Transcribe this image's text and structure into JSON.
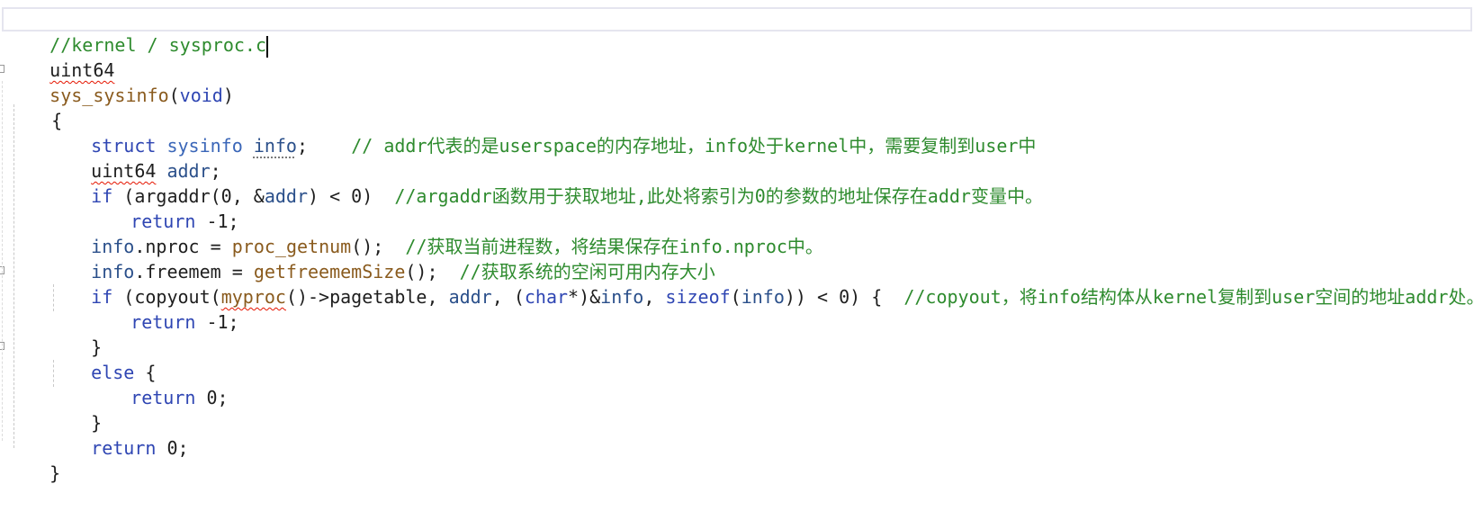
{
  "colors": {
    "comment": "#2e8b2e",
    "keyword": "#2f46b3",
    "type": "#3a66b8",
    "function": "#8a5b1e",
    "variable": "#2a4f8a",
    "text": "#1e1e1e",
    "squiggle": "#e51400",
    "current_line_border": "#e5e5ef"
  },
  "code": {
    "header_comment": "//kernel / sysproc.c",
    "line2": {
      "type": "uint64"
    },
    "line3": {
      "func": "sys_sysinfo",
      "paren_open": "(",
      "param": "void",
      "paren_close": ")"
    },
    "line4": {
      "brace": "{"
    },
    "line5": {
      "kw": "struct",
      "type": "sysinfo",
      "var": "info",
      "semi": ";",
      "comment": "// addr代表的是userspace的内存地址，info处于kernel中，需要复制到user中"
    },
    "line6": {
      "type": "uint64",
      "var": "addr",
      "semi": ";"
    },
    "line7": {
      "kw": "if",
      "pre": " (argaddr(0, &",
      "var": "addr",
      "post": ") < 0)  ",
      "comment": "//argaddr函数用于获取地址,此处将索引为0的参数的地址保存在addr变量中。"
    },
    "line8": {
      "kw": "return",
      "rest": " -1;"
    },
    "line9": {
      "var": "info",
      "dot": ".",
      "field": "nproc",
      "eq": " = ",
      "func": "proc_getnum",
      "call": "();  ",
      "comment": "//获取当前进程数，将结果保存在info.nproc中。"
    },
    "line10": {
      "var": "info",
      "dot": ".",
      "field": "freemem",
      "eq": " = ",
      "func": "getfreememSize",
      "call": "();  ",
      "comment": "//获取系统的空闲可用内存大小"
    },
    "line11": {
      "kw": "if",
      "p1": " (copyout(",
      "func": "myproc",
      "p2": "()->pagetable, ",
      "var1": "addr",
      "p3": ", (",
      "kw2": "char",
      "p4": "*)&",
      "var2": "info",
      "p5": ", ",
      "kw3": "sizeof",
      "p6": "(",
      "var3": "info",
      "p7": ")) < 0) {  ",
      "comment": "//copyout，将info结构体从kernel复制到user空间的地址addr处。"
    },
    "line12": {
      "kw": "return",
      "rest": " -1;"
    },
    "line13": {
      "brace": "}"
    },
    "line14": {
      "kw": "else",
      "rest": " {"
    },
    "line15": {
      "kw": "return",
      "rest": " 0;"
    },
    "line16": {
      "brace": "}"
    },
    "line17": {
      "kw": "return",
      "rest": " 0;"
    },
    "line18": {
      "brace": "}"
    }
  }
}
